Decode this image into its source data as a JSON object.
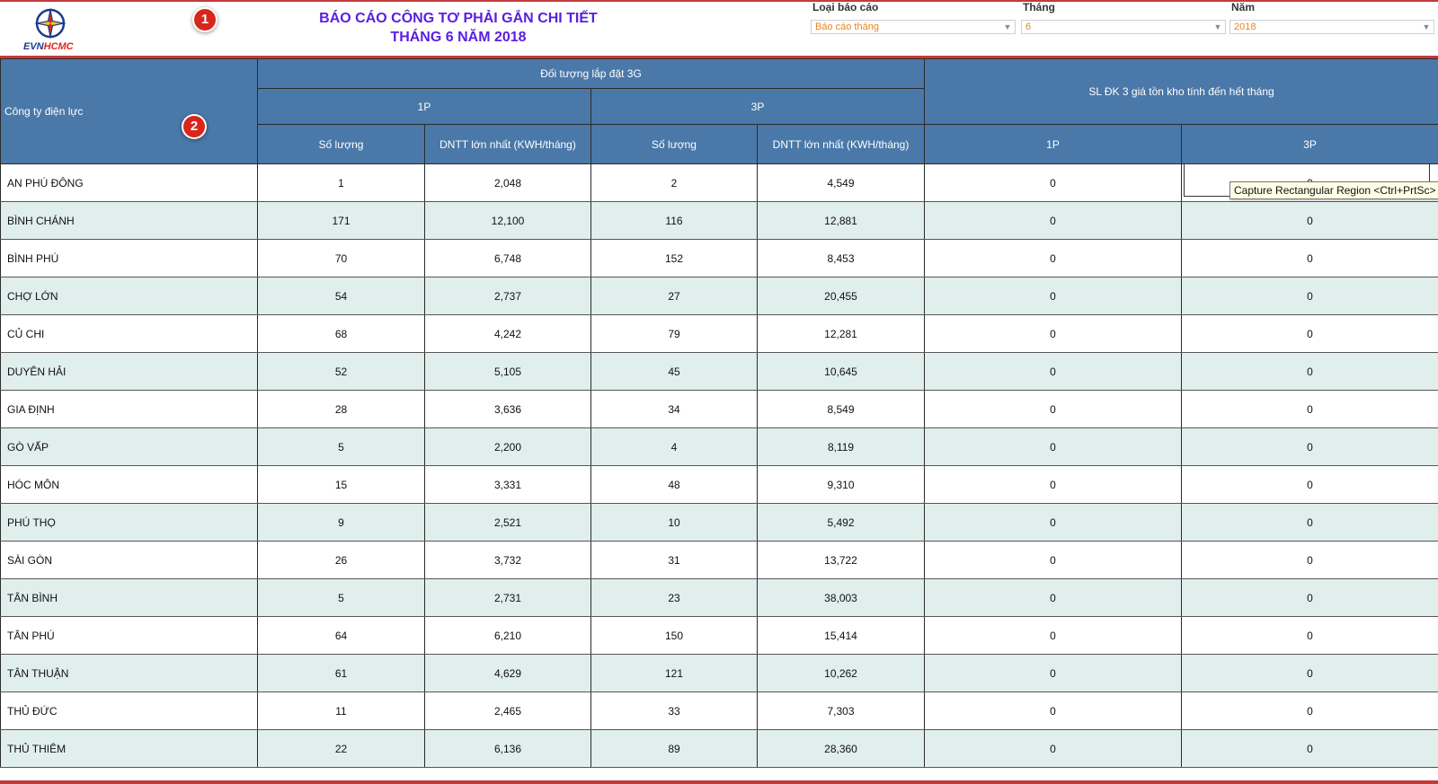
{
  "header": {
    "logo": {
      "evn": "EVN",
      "hcmc": "HCMC"
    },
    "title_line1": "BÁO CÁO CÔNG TƠ PHẢI GẮN CHI TIẾT",
    "title_line2": "THÁNG 6 NĂM 2018",
    "badge1": "1",
    "badge2": "2"
  },
  "filters": {
    "report_type": {
      "label": "Loại báo cáo",
      "value": "Báo cáo tháng"
    },
    "month": {
      "label": "Tháng",
      "value": "6"
    },
    "year": {
      "label": "Năm",
      "value": "2018"
    }
  },
  "table": {
    "headers": {
      "company": "Công ty điện lực",
      "group_3g": "Đối tượng lắp đặt 3G",
      "p1": "1P",
      "p3": "3P",
      "qty": "Số lượng",
      "dntt": "DNTT lớn nhất (KWH/tháng)",
      "stock": "SL ĐK 3 giá tồn kho tính đến hết tháng",
      "stock_1p": "1P",
      "stock_3p": "3P"
    },
    "rows": [
      {
        "name": "AN PHÚ ĐÔNG",
        "q1": "1",
        "d1": "2,048",
        "q3": "2",
        "d3": "4,549",
        "s1": "0",
        "s3": "0"
      },
      {
        "name": "BÌNH CHÁNH",
        "q1": "171",
        "d1": "12,100",
        "q3": "116",
        "d3": "12,881",
        "s1": "0",
        "s3": "0"
      },
      {
        "name": "BÌNH PHÚ",
        "q1": "70",
        "d1": "6,748",
        "q3": "152",
        "d3": "8,453",
        "s1": "0",
        "s3": "0"
      },
      {
        "name": "CHỢ LỚN",
        "q1": "54",
        "d1": "2,737",
        "q3": "27",
        "d3": "20,455",
        "s1": "0",
        "s3": "0"
      },
      {
        "name": "CỦ CHI",
        "q1": "68",
        "d1": "4,242",
        "q3": "79",
        "d3": "12,281",
        "s1": "0",
        "s3": "0"
      },
      {
        "name": "DUYÊN HẢI",
        "q1": "52",
        "d1": "5,105",
        "q3": "45",
        "d3": "10,645",
        "s1": "0",
        "s3": "0"
      },
      {
        "name": "GIA ĐỊNH",
        "q1": "28",
        "d1": "3,636",
        "q3": "34",
        "d3": "8,549",
        "s1": "0",
        "s3": "0"
      },
      {
        "name": "GÒ VẤP",
        "q1": "5",
        "d1": "2,200",
        "q3": "4",
        "d3": "8,119",
        "s1": "0",
        "s3": "0"
      },
      {
        "name": "HÓC MÔN",
        "q1": "15",
        "d1": "3,331",
        "q3": "48",
        "d3": "9,310",
        "s1": "0",
        "s3": "0"
      },
      {
        "name": "PHÚ THỌ",
        "q1": "9",
        "d1": "2,521",
        "q3": "10",
        "d3": "5,492",
        "s1": "0",
        "s3": "0"
      },
      {
        "name": "SÀI GÒN",
        "q1": "26",
        "d1": "3,732",
        "q3": "31",
        "d3": "13,722",
        "s1": "0",
        "s3": "0"
      },
      {
        "name": "TÂN BÌNH",
        "q1": "5",
        "d1": "2,731",
        "q3": "23",
        "d3": "38,003",
        "s1": "0",
        "s3": "0"
      },
      {
        "name": "TÂN PHÚ",
        "q1": "64",
        "d1": "6,210",
        "q3": "150",
        "d3": "15,414",
        "s1": "0",
        "s3": "0"
      },
      {
        "name": "TÂN THUẬN",
        "q1": "61",
        "d1": "4,629",
        "q3": "121",
        "d3": "10,262",
        "s1": "0",
        "s3": "0"
      },
      {
        "name": "THỦ ĐỨC",
        "q1": "11",
        "d1": "2,465",
        "q3": "33",
        "d3": "7,303",
        "s1": "0",
        "s3": "0"
      },
      {
        "name": "THỦ THIÊM",
        "q1": "22",
        "d1": "6,136",
        "q3": "89",
        "d3": "28,360",
        "s1": "0",
        "s3": "0"
      }
    ]
  },
  "tooltip": "Capture Rectangular Region <Ctrl+PrtSc>",
  "icons": {
    "logo": "evn-star-logo-icon",
    "dropdown": "chevron-down-icon"
  },
  "colors": {
    "header_bg": "#4a78a8",
    "title": "#5a1fe0",
    "accent": "#c23a3a",
    "row_alt": "#e0eeec"
  }
}
